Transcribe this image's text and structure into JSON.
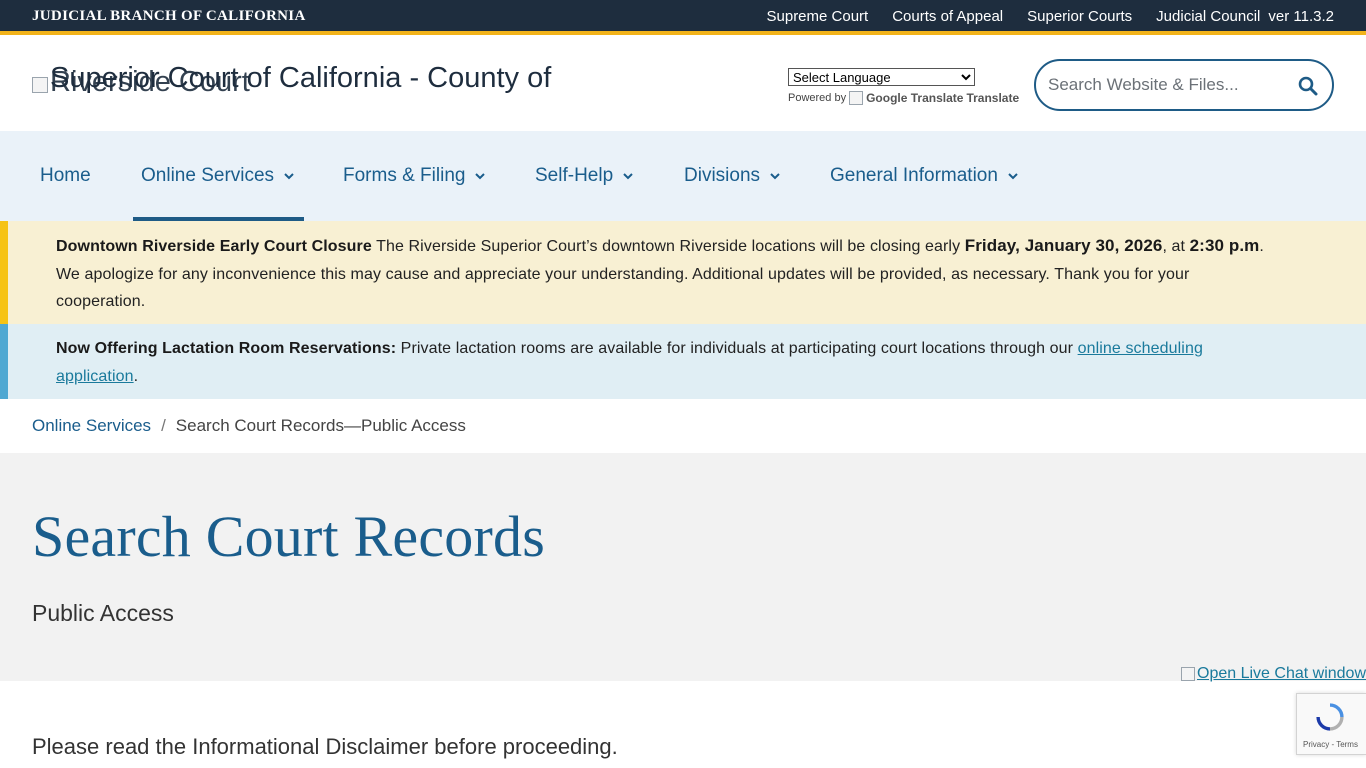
{
  "topbar": {
    "brand": "JUDICIAL BRANCH OF CALIFORNIA",
    "links": [
      "Supreme Court",
      "Courts of Appeal",
      "Superior Courts",
      "Judicial Council"
    ],
    "version": "ver 11.3.2"
  },
  "header": {
    "logo_alt_line1": "Superior Court of California - County of",
    "logo_alt_line2": "Riverside Court",
    "translate_select": "Select Language",
    "powered_by": "Powered by",
    "google_translate_alt": "Google Translate",
    "translate_label": "Translate",
    "search_placeholder": "Search Website & Files..."
  },
  "nav": {
    "items": [
      {
        "label": "Home"
      },
      {
        "label": "Online Services"
      },
      {
        "label": "Forms & Filing"
      },
      {
        "label": "Self-Help"
      },
      {
        "label": "Divisions"
      },
      {
        "label": "General Information"
      }
    ]
  },
  "alerts": {
    "closure": {
      "title": "Downtown Riverside Early Court Closure",
      "text1": " The Riverside Superior Court’s downtown Riverside locations will be closing early ",
      "date": "Friday, January 30, 2026",
      "text2": ", at ",
      "time": "2:30 p.m",
      "text3": ". We apologize for any inconvenience this may cause and appreciate your understanding. Additional updates will be provided, as necessary. Thank you for your cooperation."
    },
    "lactation": {
      "title": "Now Offering Lactation Room Reservations:",
      "text": " Private lactation rooms are available for individuals at participating court locations through our ",
      "link": "online scheduling application",
      "end": "."
    }
  },
  "breadcrumb": {
    "parent": "Online Services",
    "separator": "/",
    "current": "Search Court Records—Public Access"
  },
  "hero": {
    "title": "Search Court Records",
    "subtitle": "Public Access"
  },
  "chat": {
    "label": "Open Live Chat window"
  },
  "content": {
    "disclaimer": "Please read the Informational Disclaimer before proceeding."
  },
  "recaptcha": {
    "text": "Privacy - Terms"
  },
  "colors": {
    "topbar_bg": "#1e2d3e",
    "accent_gold": "#f2b31a",
    "link_blue": "#1a5d8c",
    "nav_bg": "#eaf2f9",
    "alert_yellow_bg": "#f8f0d3",
    "alert_blue_bg": "#e0eef4"
  }
}
